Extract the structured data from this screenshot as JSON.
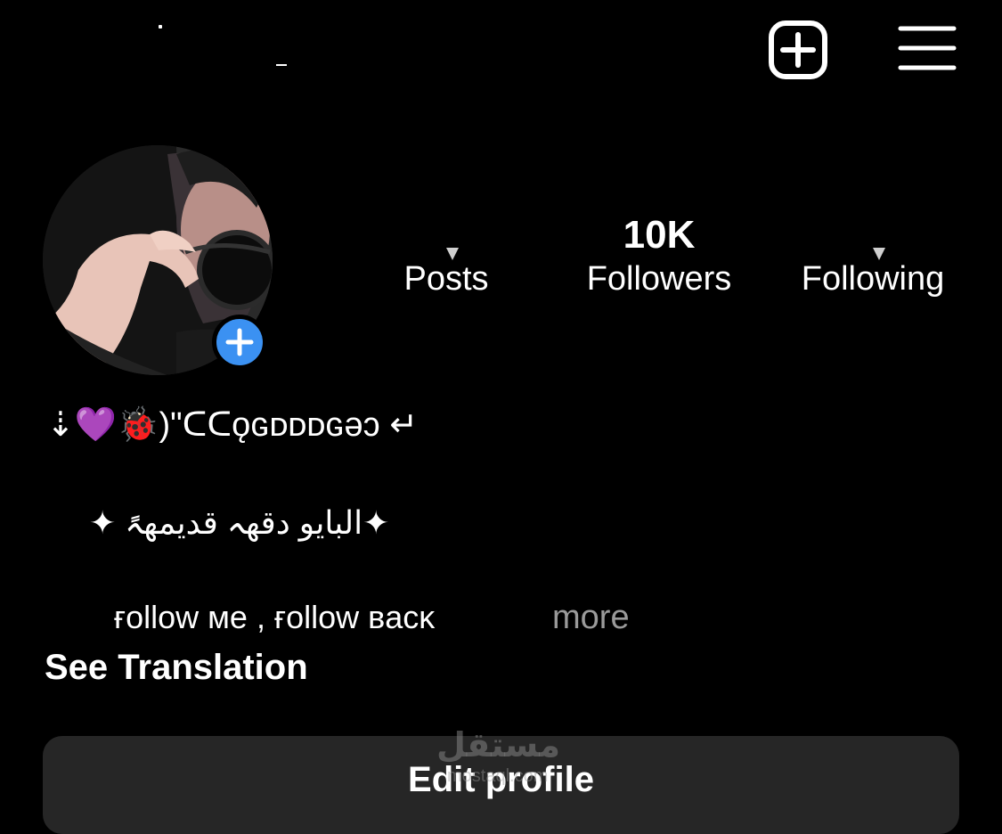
{
  "header": {
    "username": "",
    "new_post_icon": "plus-square-icon",
    "menu_icon": "hamburger-menu-icon"
  },
  "profile": {
    "avatar_alt": "profile picture",
    "add_story_icon": "plus-icon",
    "accent": "#3b91f2"
  },
  "stats": {
    "posts": {
      "value": "",
      "label": "Posts"
    },
    "followers": {
      "value": "10K",
      "label": "Followers"
    },
    "following": {
      "value": "",
      "label": "Following"
    }
  },
  "bio": {
    "name_line": "⇣💜🐞)\"ᑕᑕǫɢᴅᴅᴅɢǝɔ ↵",
    "arabic_line": "✦البايو دقهہ قديمهہً ✦",
    "follow_line": "ғollow мe , ғollow вacĸ",
    "more_label": "more",
    "see_translation": "See Translation"
  },
  "actions": {
    "edit_profile": "Edit profile"
  },
  "watermark": {
    "text": "مستقل",
    "sub": "mostaql.com"
  },
  "colors": {
    "background": "#000000",
    "text": "#ffffff",
    "muted": "#9a9a9a",
    "button_bg": "#262626"
  }
}
